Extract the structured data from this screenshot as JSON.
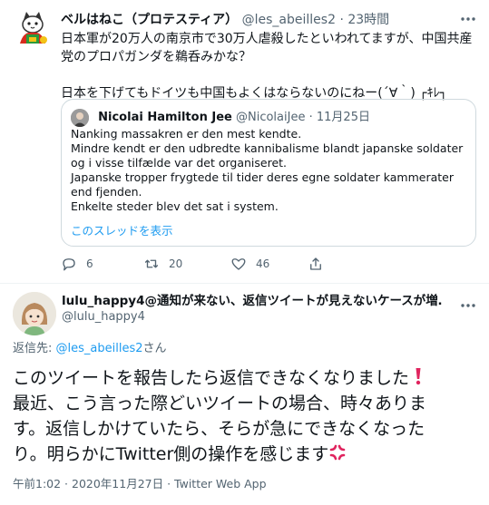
{
  "tweet": {
    "author_name": "ベルはねこ（プロテスティア）",
    "author_handle": "@les_abeilles2",
    "separator": "·",
    "time": "23時間",
    "text": "日本軍が20万人の南京市で30万人虐殺したといわれてますが、中国共産党のプロパガンダを鵜呑みかな？\n\n日本を下げてもドイツも中国もよくはならないのにねー(´∀｀) ┌ｷﾚ┐",
    "quoted": {
      "author_name": "Nicolai Hamilton Jee",
      "author_handle": "@NicolaiJee",
      "separator": "·",
      "date": "11月25日",
      "text": "Nanking massakren er den mest kendte.\nMindre kendt er den udbredte kannibalisme blandt japanske soldater og i visse tilfælde var det organiseret.\nJapanske tropper frygtede til tider deres egne soldater kammerater end fjenden.\nEnkelte steder blev det sat i system.",
      "thread_link": "このスレッドを表示"
    },
    "actions": {
      "reply_count": "6",
      "retweet_count": "20",
      "like_count": "46"
    }
  },
  "reply": {
    "author_name": "lulu_happy4@通知が来ない、返信ツイートが見えないケースが増…",
    "author_handle": "@lulu_happy4",
    "reply_to_label": "返信先: ",
    "reply_to_handle": "@les_abeilles2",
    "reply_to_suffix": "さん",
    "text_main": "このツイートを報告したら返信できなくなりました",
    "text_rest": "\n最近、こう言った際どいツイートの場合、時々ありま\nす。返信しかけていたら、そらが急にできなくなった\nり。明らかにTwitter側の操作を感じます",
    "timestamp": "午前1:02 · 2020年11月27日 · Twitter Web App"
  },
  "colors": {
    "text": "#0f1419",
    "muted": "#536471",
    "link": "#1d9bf0",
    "border": "#cfd9de",
    "emoji_red": "#e0245e"
  },
  "icons": [
    "cat-avatar-icon",
    "more-icon",
    "reply-icon",
    "retweet-icon",
    "like-icon",
    "share-icon",
    "exclamation-emoji-icon",
    "anger-emoji-icon"
  ]
}
